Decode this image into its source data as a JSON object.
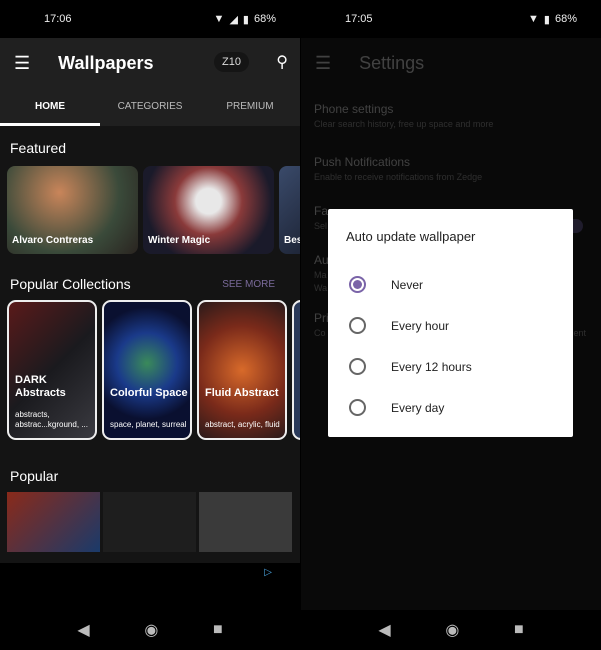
{
  "left": {
    "status": {
      "time": "17:06",
      "battery": "68%"
    },
    "appbar": {
      "title": "Wallpapers",
      "badge": "Z10"
    },
    "tabs": [
      "HOME",
      "CATEGORIES",
      "PREMIUM"
    ],
    "featured": {
      "heading": "Featured",
      "items": [
        "Alvaro Contreras",
        "Winter Magic",
        "Best"
      ]
    },
    "collections": {
      "heading": "Popular Collections",
      "see_more": "SEE MORE",
      "items": [
        {
          "name": "DARK Abstracts",
          "tags": "abstracts, abstrac...kground, ..."
        },
        {
          "name": "Colorful Space",
          "tags": "space, planet, surreal"
        },
        {
          "name": "Fluid Abstract",
          "tags": "abstract, acrylic, fluid"
        }
      ]
    },
    "popular": {
      "heading": "Popular"
    }
  },
  "right": {
    "status": {
      "time": "17:05",
      "battery": "68%"
    },
    "appbar": {
      "title": "Settings"
    },
    "settings": [
      {
        "title": "Phone settings",
        "subtitle": "Clear search history, free up space and more"
      },
      {
        "title": "Push Notifications",
        "subtitle": "Enable to receive notifications from Zedge"
      },
      {
        "title": "Fa",
        "subtitle": "Sel"
      },
      {
        "title": "Au",
        "subtitle": "Ma",
        "subtitle2": "Wa"
      },
      {
        "title": "Pri",
        "subtitle": "Co",
        "suffix": "ent"
      }
    ],
    "dialog": {
      "title": "Auto update wallpaper",
      "options": [
        "Never",
        "Every hour",
        "Every 12 hours",
        "Every day"
      ],
      "selected": 0
    },
    "accent": "#7a64a8"
  }
}
